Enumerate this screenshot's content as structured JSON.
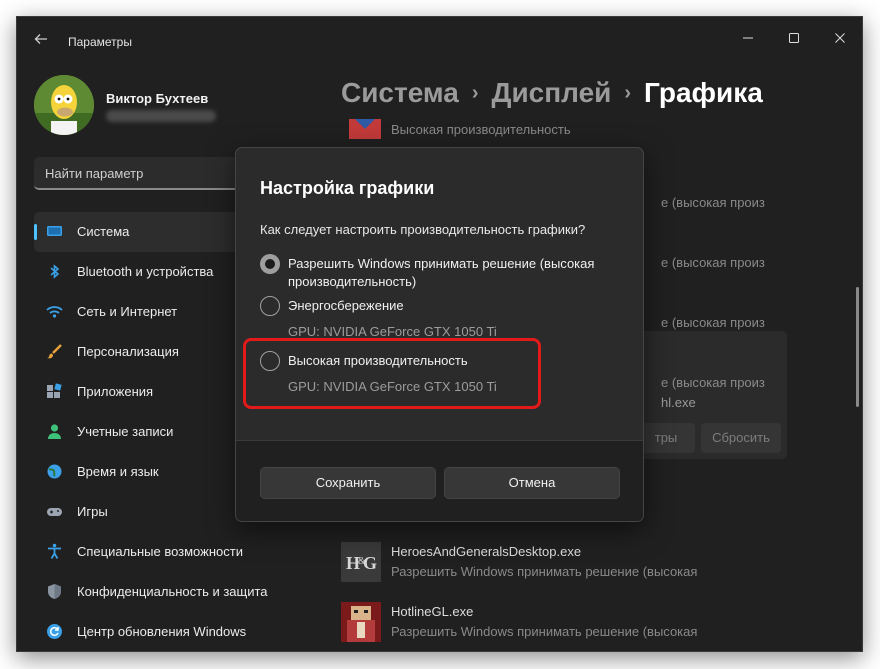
{
  "window": {
    "title": "Параметры",
    "controls": {
      "minimize": "—",
      "maximize": "☐",
      "close": "✕"
    }
  },
  "user": {
    "name": "Виктор Бухтеев"
  },
  "search": {
    "placeholder": "Найти параметр"
  },
  "sidebar": {
    "accent_color": "#4cc2ff",
    "items": [
      {
        "label": "Система",
        "icon": "system-icon",
        "active": true
      },
      {
        "label": "Bluetooth и устройства",
        "icon": "bluetooth-icon"
      },
      {
        "label": "Сеть и Интернет",
        "icon": "wifi-icon"
      },
      {
        "label": "Персонализация",
        "icon": "brush-icon"
      },
      {
        "label": "Приложения",
        "icon": "apps-icon"
      },
      {
        "label": "Учетные записи",
        "icon": "account-icon"
      },
      {
        "label": "Время и язык",
        "icon": "globe-icon"
      },
      {
        "label": "Игры",
        "icon": "gamepad-icon"
      },
      {
        "label": "Специальные возможности",
        "icon": "accessibility-icon"
      },
      {
        "label": "Конфиденциальность и защита",
        "icon": "shield-icon"
      },
      {
        "label": "Центр обновления Windows",
        "icon": "update-icon"
      }
    ]
  },
  "breadcrumb": {
    "items": [
      "Система",
      "Дисплей"
    ],
    "separator": "›",
    "current": "Графика"
  },
  "background": {
    "top_app_sub": "Высокая производительность",
    "partial_texts": [
      "е (высокая произ",
      "е (высокая произ",
      "е (высокая произ",
      "hl.exe",
      "е (высокая произ"
    ],
    "options_button": "тры",
    "reset_button": "Сбросить",
    "apps": [
      {
        "name": "HeroesAndGeneralsDesktop.exe",
        "sub": "Разрешить Windows принимать решение (высокая",
        "icon": "hng-app-icon"
      },
      {
        "name": "HotlineGL.exe",
        "sub": "Разрешить Windows принимать решение (высокая",
        "icon": "hotline-app-icon"
      }
    ]
  },
  "dialog": {
    "title": "Настройка графики",
    "question": "Как следует настроить производительность графики?",
    "options": [
      {
        "label": "Разрешить Windows принимать решение (высокая производительность)",
        "gpu": "",
        "checked": true
      },
      {
        "label": "Энергосбережение",
        "gpu": "GPU: NVIDIA GeForce GTX 1050 Ti",
        "checked": false
      },
      {
        "label": "Высокая производительность",
        "gpu": "GPU: NVIDIA GeForce GTX 1050 Ti",
        "checked": false
      }
    ],
    "save_button": "Сохранить",
    "cancel_button": "Отмена"
  },
  "highlight_color": "#e21a1a"
}
